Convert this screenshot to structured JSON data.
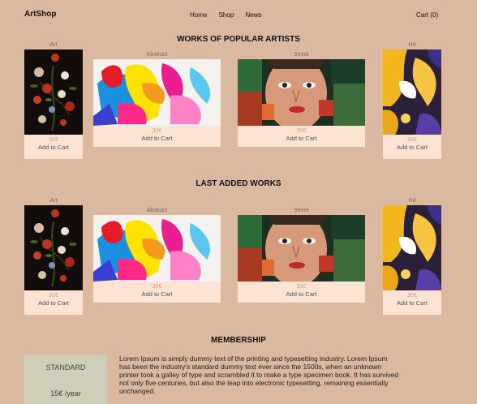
{
  "nav": {
    "brand": "ArtShop",
    "links": [
      "Home",
      "Shop",
      "News"
    ],
    "cart": "Cart (0)"
  },
  "sections": [
    {
      "title": "WORKS OF POPULAR ARTISTS",
      "cards": [
        {
          "category": "Art",
          "price": "30€",
          "action": "Add to Cart"
        },
        {
          "category": "Abstract",
          "price": "30€",
          "action": "Add to Cart"
        },
        {
          "category": "Street",
          "price": "30€",
          "action": "Add to Cart"
        },
        {
          "category": "Hd",
          "price": "30€",
          "action": "Add to Cart"
        }
      ]
    },
    {
      "title": "LAST ADDED WORKS",
      "cards": [
        {
          "category": "Art",
          "price": "30€",
          "action": "Add to Cart"
        },
        {
          "category": "Abstract",
          "price": "30€",
          "action": "Add to Cart"
        },
        {
          "category": "Street",
          "price": "30€",
          "action": "Add to Cart"
        },
        {
          "category": "Hd",
          "price": "30€",
          "action": "Add to Cart"
        }
      ]
    }
  ],
  "membership": {
    "title": "MEMBERSHIP",
    "plan_name": "STANDARD",
    "plan_price": "15€ /year",
    "text": "Lorem Ipsum is simply dummy text of the printing and typesetting industry. Lorem Ipsum has been the industry's standard dummy text ever since the 1500s, when an unknown printer took a galley of type and scrambled it to make a type specimen book. It has survived not only five centuries, but also the leap into electronic typesetting, remaining essentially unchanged."
  }
}
